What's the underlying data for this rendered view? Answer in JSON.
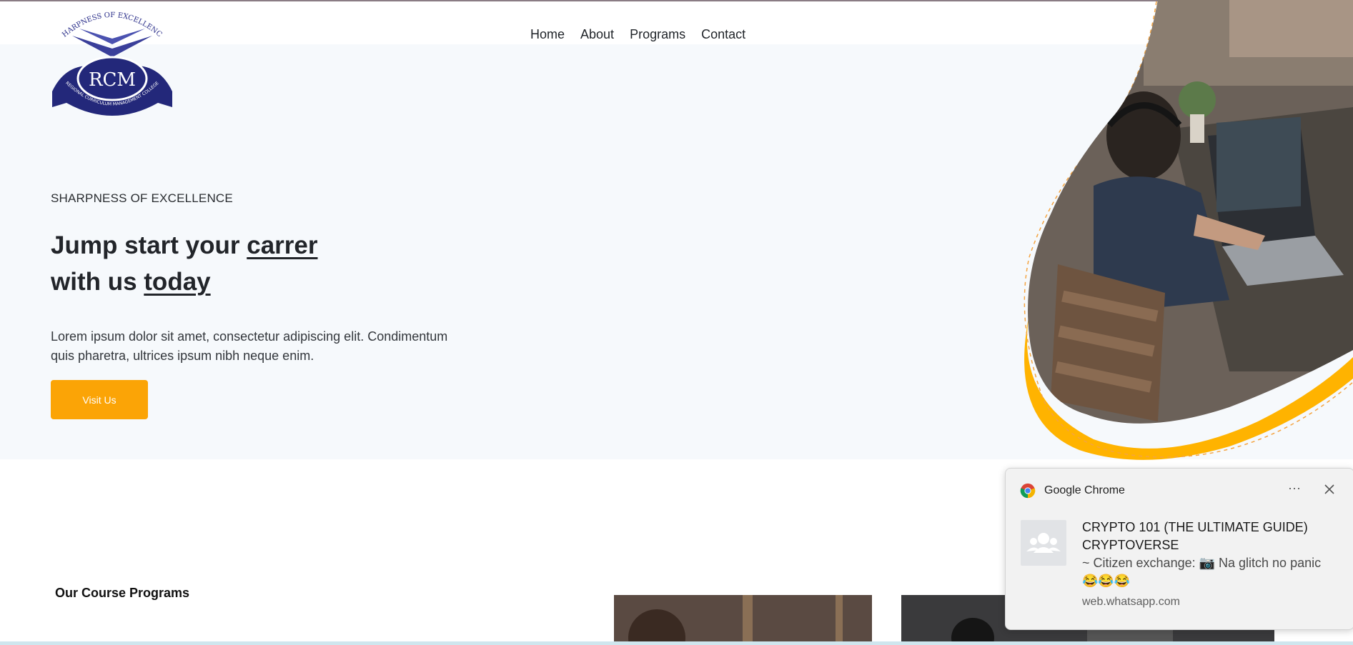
{
  "nav": {
    "items": [
      "Home",
      "About",
      "Programs",
      "Contact"
    ]
  },
  "logo": {
    "arc_text": "SHARPNESS OF EXCELLENCE",
    "initials": "RCM",
    "ribbon_text": "REGIONAL CURRICULUM MANAGEMENT COLLEGE",
    "color": "#2b2f8a"
  },
  "hero": {
    "tagline": "SHARPNESS OF EXCELLENCE",
    "headline_part1": "Jump start your ",
    "headline_u1": "carrer",
    "headline_part2": "with us ",
    "headline_u2": "today",
    "lead": "Lorem ipsum dolor sit amet, consectetur adipiscing elit. Condimentum quis pharetra, ultrices ipsum nibh neque enim.",
    "button_label": "Visit Us",
    "accent_color": "#fba406",
    "wave_color": "#ffb300"
  },
  "programs": {
    "title": "Our Course Programs"
  },
  "notification": {
    "app": "Google Chrome",
    "more_icon": "ellipsis-icon",
    "close_icon": "close-icon",
    "title_line1": "CRYPTO 101 (THE ULTIMATE GUIDE)",
    "title_line2": "CRYPTOVERSE",
    "body_line1": "~ Citizen exchange: 📷 Na glitch no panic",
    "body_line2": "😂😂😂",
    "source": "web.whatsapp.com"
  }
}
